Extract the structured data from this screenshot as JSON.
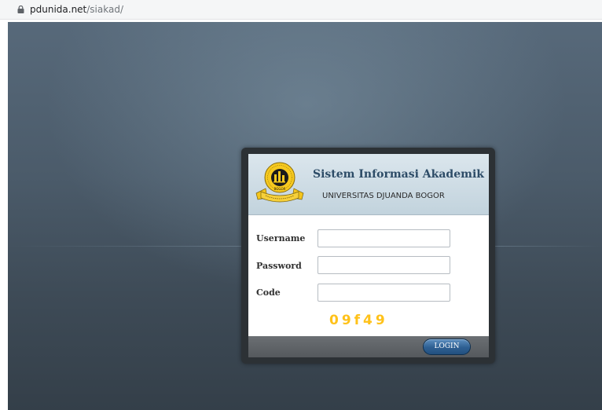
{
  "browser": {
    "url_host": "pdunida.net",
    "url_path": "/siakad/"
  },
  "header": {
    "title": "Sistem Informasi Akademik",
    "subtitle": "UNIVERSITAS DJUANDA BOGOR",
    "logo_text": "BOGOR",
    "logo_icon": "university-seal-icon"
  },
  "form": {
    "username_label": "Username",
    "username_value": "",
    "password_label": "Password",
    "password_value": "",
    "code_label": "Code",
    "code_value": "",
    "captcha_text": "09f49"
  },
  "footer": {
    "login_label": "LOGIN"
  },
  "colors": {
    "title": "#2d4c67",
    "captcha": "#ffc21a",
    "login_button": "#2e5f92",
    "footer_bar": "#5f6367"
  }
}
